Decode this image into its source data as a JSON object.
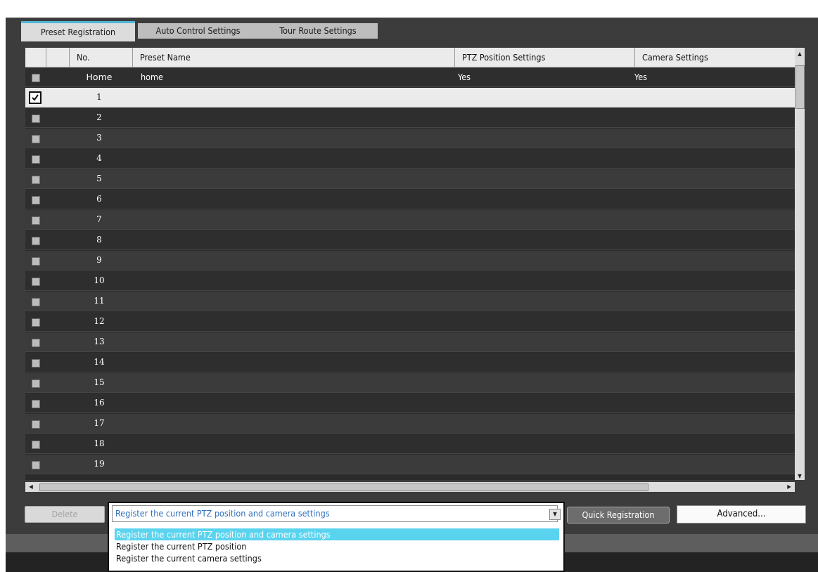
{
  "tabs": [
    "Preset Registration",
    "Auto Control Settings",
    "Tour Route Settings"
  ],
  "table": {
    "headers": [
      "No.",
      "Preset Name",
      "PTZ Position Settings",
      "Camera Settings"
    ],
    "home": {
      "no": "Home",
      "name": "home",
      "ptz": "Yes",
      "camera": "Yes"
    },
    "rows": [
      "1",
      "2",
      "3",
      "4",
      "5",
      "6",
      "7",
      "8",
      "9",
      "10",
      "11",
      "12",
      "13",
      "14",
      "15",
      "16",
      "17",
      "18",
      "19"
    ],
    "selected_row": "1"
  },
  "buttons": {
    "delete": "Delete",
    "quick_registration": "Quick Registration",
    "advanced": "Advanced..."
  },
  "register_mode": {
    "selected": "Register the current PTZ position and camera settings",
    "options": [
      "Register the current PTZ position and camera settings",
      "Register the current PTZ position",
      "Register the current camera settings"
    ]
  },
  "colors": {
    "tab_accent": "#4fb6d6",
    "option_highlight": "#5ad3ee",
    "selected_value_text": "#2e6fbf"
  }
}
